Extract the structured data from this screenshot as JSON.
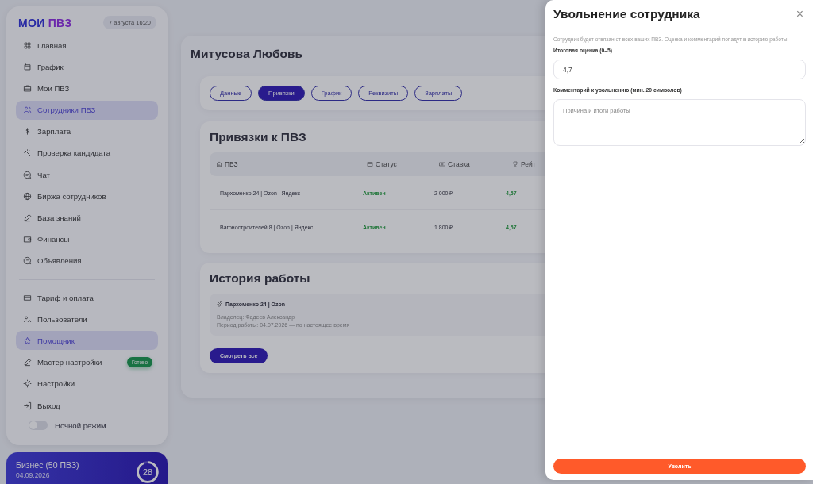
{
  "sidebar": {
    "logo": {
      "part_1": "МОИ",
      "part_2": "ПВЗ"
    },
    "datetime": "7 августа 16:20",
    "groups": [
      [
        {
          "label": "Главная",
          "selected": false
        },
        {
          "label": "График",
          "selected": false
        },
        {
          "label": "Мои ПВЗ",
          "selected": false
        },
        {
          "label": "Сотрудники ПВЗ",
          "selected": true
        },
        {
          "label": "Зарплата",
          "selected": false
        },
        {
          "label": "Проверка кандидата",
          "selected": false
        },
        {
          "label": "Чат",
          "selected": false
        },
        {
          "label": "Биржа сотрудников",
          "selected": false
        },
        {
          "label": "База знаний",
          "selected": false
        },
        {
          "label": "Финансы",
          "selected": false
        },
        {
          "label": "Объявления",
          "selected": false
        }
      ],
      [
        {
          "label": "Тариф и оплата",
          "selected": false
        },
        {
          "label": "Пользователи",
          "selected": false
        },
        {
          "label": "Помощник",
          "selected": true
        },
        {
          "label": "Мастер настройки",
          "selected": false,
          "badge": "Готово"
        },
        {
          "label": "Настройки",
          "selected": false
        },
        {
          "label": "Выход",
          "selected": false
        }
      ]
    ],
    "night_mode": {
      "label": "Ночной режим",
      "on": false
    },
    "plan": {
      "name": "Бизнес (50 ПВЗ)",
      "date": "04.09.2026",
      "days": "28",
      "level": 0.93
    }
  },
  "main": {
    "title": "Митусова Любовь",
    "tabs": [
      {
        "label": "Данные",
        "selected": false
      },
      {
        "label": "Привязки",
        "selected": true
      },
      {
        "label": "График",
        "selected": false
      },
      {
        "label": "Реквизиты",
        "selected": false
      },
      {
        "label": "Зарплаты",
        "selected": false
      }
    ],
    "bindings": {
      "title": "Привязки к ПВЗ",
      "columns": [
        "ПВЗ",
        "Статус",
        "Ставка",
        "Рейт"
      ],
      "rows": [
        {
          "pvz": "Пархоменко 24 | Ozon | Яндекс",
          "status": "Активен",
          "rate": "2 000 ₽",
          "rating": "4,57"
        },
        {
          "pvz": "Вагоностроителей 8 | Ozon | Яндекс",
          "status": "Активен",
          "rate": "1 800 ₽",
          "rating": "4,57"
        }
      ]
    },
    "history": {
      "title": "История работы",
      "items": [
        {
          "place": "Пархоменко 24 | Ozon",
          "owner": "Владелец: Фадеев Александр",
          "period": "Период работы: 04.07.2026 — по настоящее время"
        }
      ],
      "button": "Смотреть все"
    }
  },
  "drawer": {
    "title": "Увольнение сотрудника",
    "close": "×",
    "description": "Сотрудник будет отвязан от всех ваших ПВЗ. Оценка и комментарий попадут в историю работы.",
    "rating_label": "Итоговая оценка (0–5)",
    "rating_value": "4,7",
    "comment_label": "Комментарий к увольнению (мин. 20 символов)",
    "comment_placeholder": "Причина и итоги работы",
    "submit": "Уволить"
  }
}
